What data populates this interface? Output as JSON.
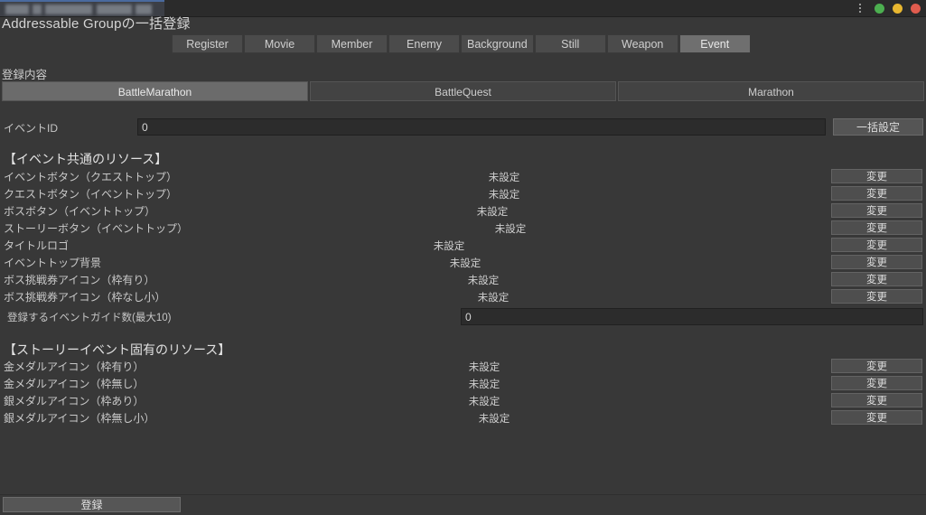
{
  "window": {
    "chrome_tab_title": "",
    "controls": [
      {
        "name": "minimize-dot",
        "color": "#4caf50"
      },
      {
        "name": "maximize-dot",
        "color": "#e8b730"
      },
      {
        "name": "close-dot",
        "color": "#e05c4e"
      }
    ],
    "menu_icon": "kebab-menu-icon"
  },
  "app": {
    "title": "Addressable Groupの一括登録"
  },
  "main_tabs": [
    {
      "label": "Register",
      "selected": false
    },
    {
      "label": "Movie",
      "selected": false
    },
    {
      "label": "Member",
      "selected": false
    },
    {
      "label": "Enemy",
      "selected": false
    },
    {
      "label": "Background",
      "selected": false
    },
    {
      "label": "Still",
      "selected": false
    },
    {
      "label": "Weapon",
      "selected": false
    },
    {
      "label": "Event",
      "selected": true
    }
  ],
  "content": {
    "section_label": "登録内容",
    "sub_tabs": [
      {
        "label": "BattleMarathon",
        "selected": true
      },
      {
        "label": "BattleQuest",
        "selected": false
      },
      {
        "label": "Marathon",
        "selected": false
      }
    ],
    "event_id": {
      "label": "イベントID",
      "value": "0",
      "placeholder": ""
    },
    "bulk_set_button": "一括設定",
    "common_heading": "【イベント共通のリソース】",
    "common_rows": [
      {
        "label": "イベントボタン（クエストトップ）",
        "value": "未設定",
        "button": "変更",
        "value_x": 558
      },
      {
        "label": "クエストボタン（イベントトップ）",
        "value": "未設定",
        "button": "変更",
        "value_x": 558
      },
      {
        "label": "ボスボタン（イベントトップ）",
        "value": "未設定",
        "button": "変更",
        "value_x": 545
      },
      {
        "label": "ストーリーボタン（イベントトップ）",
        "value": "未設定",
        "button": "変更",
        "value_x": 565
      },
      {
        "label": "タイトルロゴ",
        "value": "未設定",
        "button": "変更",
        "value_x": 497
      },
      {
        "label": "イベントトップ背景",
        "value": "未設定",
        "button": "変更",
        "value_x": 515
      },
      {
        "label": "ボス挑戦券アイコン（枠有り）",
        "value": "未設定",
        "button": "変更",
        "value_x": 535
      },
      {
        "label": "ボス挑戦券アイコン（枠なし小）",
        "value": "未設定",
        "button": "変更",
        "value_x": 546
      }
    ],
    "guide_count": {
      "label": "登録するイベントガイド数(最大10)",
      "value": "0",
      "placeholder": ""
    },
    "story_heading": "【ストーリーイベント固有のリソース】",
    "story_rows": [
      {
        "label": "金メダルアイコン（枠有り）",
        "value": "未設定",
        "button": "変更",
        "value_x": 536
      },
      {
        "label": "金メダルアイコン（枠無し）",
        "value": "未設定",
        "button": "変更",
        "value_x": 536
      },
      {
        "label": "銀メダルアイコン（枠あり）",
        "value": "未設定",
        "button": "変更",
        "value_x": 536
      },
      {
        "label": "銀メダルアイコン（枠無し小）",
        "value": "未設定",
        "button": "変更",
        "value_x": 547
      }
    ]
  },
  "footer": {
    "register_button": "登録"
  }
}
